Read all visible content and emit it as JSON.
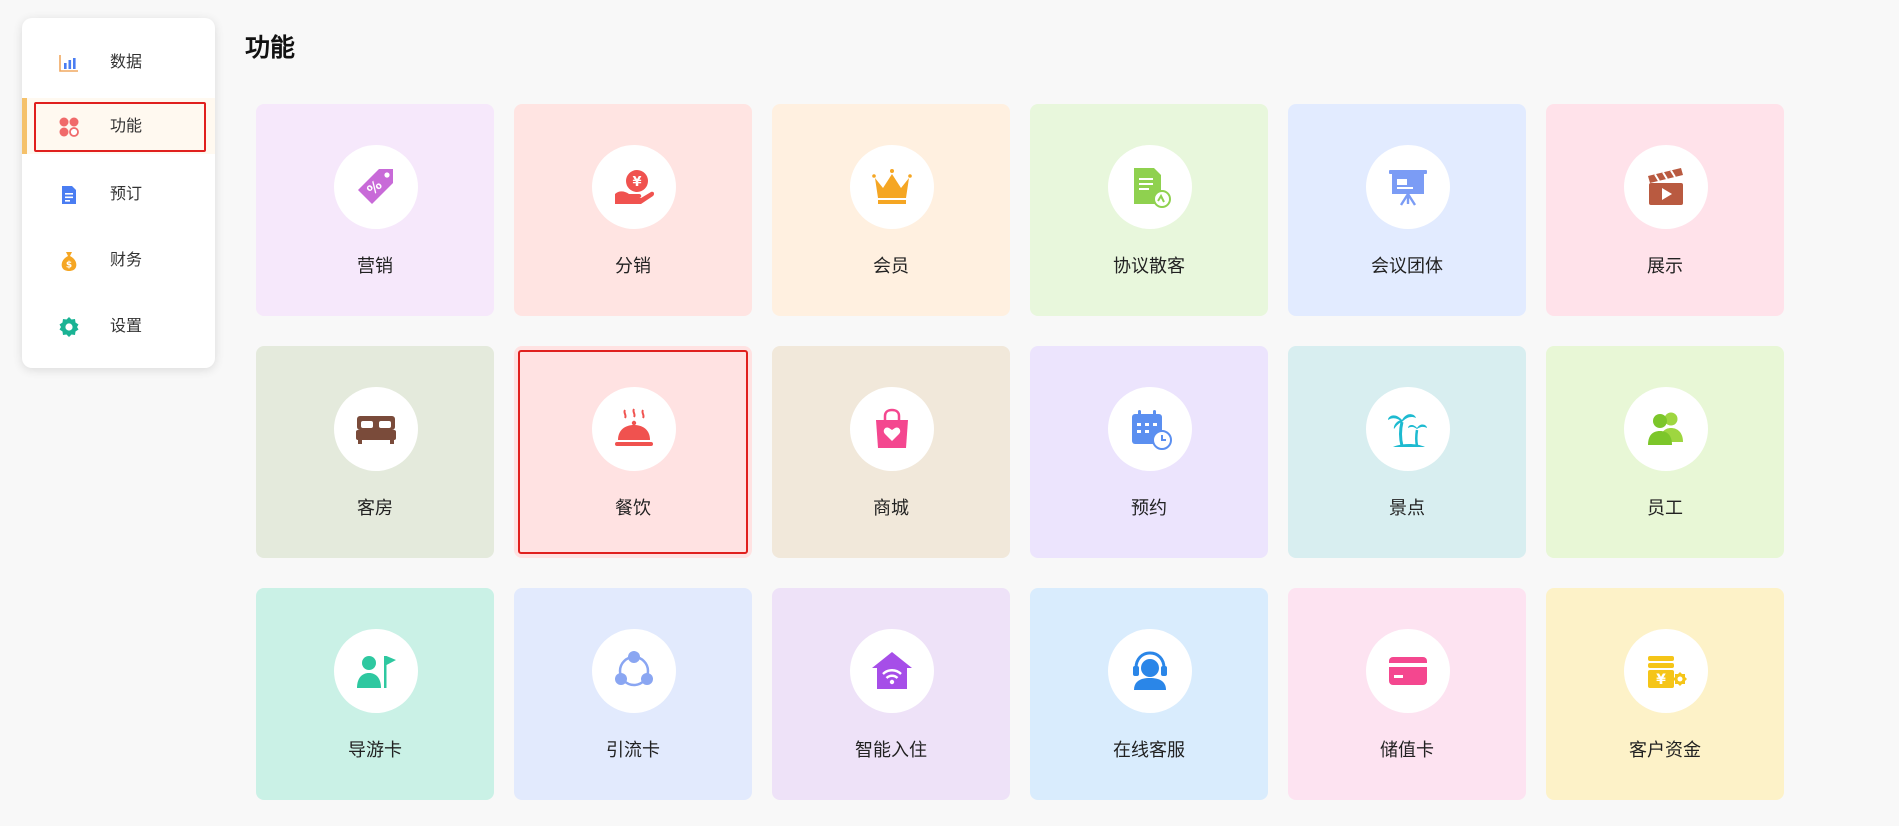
{
  "sidebar": {
    "items": [
      {
        "label": "数据",
        "icon": "bar-chart-icon",
        "active": false
      },
      {
        "label": "功能",
        "icon": "feature-grid-icon",
        "active": true
      },
      {
        "label": "预订",
        "icon": "document-icon",
        "active": false
      },
      {
        "label": "财务",
        "icon": "money-bag-icon",
        "active": false
      },
      {
        "label": "设置",
        "icon": "gear-icon",
        "active": false
      }
    ],
    "accent_color": "#f5c16a"
  },
  "main": {
    "title": "功能",
    "tiles": [
      {
        "label": "营销",
        "icon": "price-tag-icon",
        "bg": "#f6e8fb"
      },
      {
        "label": "分销",
        "icon": "yuan-hand-icon",
        "bg": "#ffe4e2"
      },
      {
        "label": "会员",
        "icon": "crown-icon",
        "bg": "#fff0e0"
      },
      {
        "label": "协议散客",
        "icon": "agreement-document-icon",
        "bg": "#e8f7dc"
      },
      {
        "label": "会议团体",
        "icon": "presentation-board-icon",
        "bg": "#e2ebff"
      },
      {
        "label": "展示",
        "icon": "clapperboard-icon",
        "bg": "#ffe2ea"
      },
      {
        "label": "客房",
        "icon": "bed-icon",
        "bg": "#e4eadc"
      },
      {
        "label": "餐饮",
        "icon": "food-cloche-icon",
        "bg": "#ffe2e2",
        "selected": true
      },
      {
        "label": "商城",
        "icon": "shopping-bag-icon",
        "bg": "#f1e8da"
      },
      {
        "label": "预约",
        "icon": "calendar-clock-icon",
        "bg": "#ece4fd"
      },
      {
        "label": "景点",
        "icon": "palm-tree-icon",
        "bg": "#d8eef0"
      },
      {
        "label": "员工",
        "icon": "staff-people-icon",
        "bg": "#e8f7d6"
      },
      {
        "label": "导游卡",
        "icon": "tour-guide-flag-icon",
        "bg": "#caf1e6"
      },
      {
        "label": "引流卡",
        "icon": "network-nodes-icon",
        "bg": "#e2eafd"
      },
      {
        "label": "智能入住",
        "icon": "smart-home-wifi-icon",
        "bg": "#eee2f8"
      },
      {
        "label": "在线客服",
        "icon": "customer-service-headset-icon",
        "bg": "#d9ecfd"
      },
      {
        "label": "储值卡",
        "icon": "stored-value-card-icon",
        "bg": "#fde3f1"
      },
      {
        "label": "客户资金",
        "icon": "customer-funds-icon",
        "bg": "#fdf2c8"
      }
    ]
  }
}
